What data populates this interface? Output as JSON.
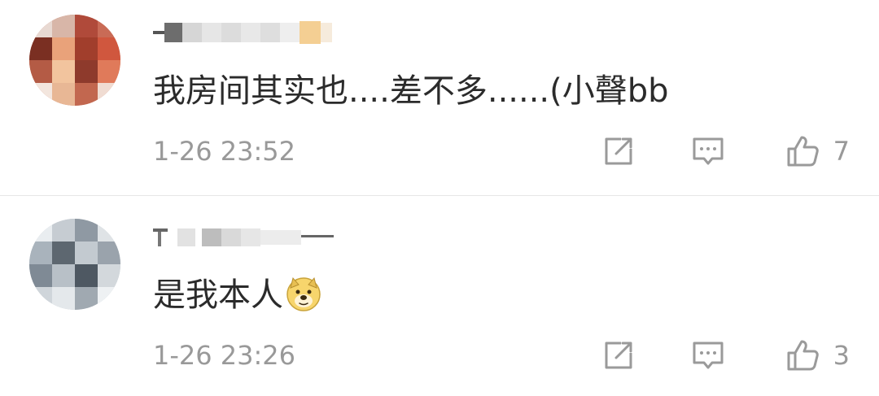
{
  "comments": [
    {
      "text": "我房间其实也....差不多......(小聲bb",
      "time": "1-26 23:52",
      "likes": "7"
    },
    {
      "text": "是我本人",
      "emoji": "doge-emoji",
      "time": "1-26 23:26",
      "likes": "3"
    }
  ],
  "icons": {
    "repost": "repost-icon",
    "reply": "comment-icon",
    "like": "thumbs-up-icon"
  },
  "colors": {
    "text": "#2b2b2b",
    "meta": "#999999",
    "divider": "#e6e6e6"
  }
}
